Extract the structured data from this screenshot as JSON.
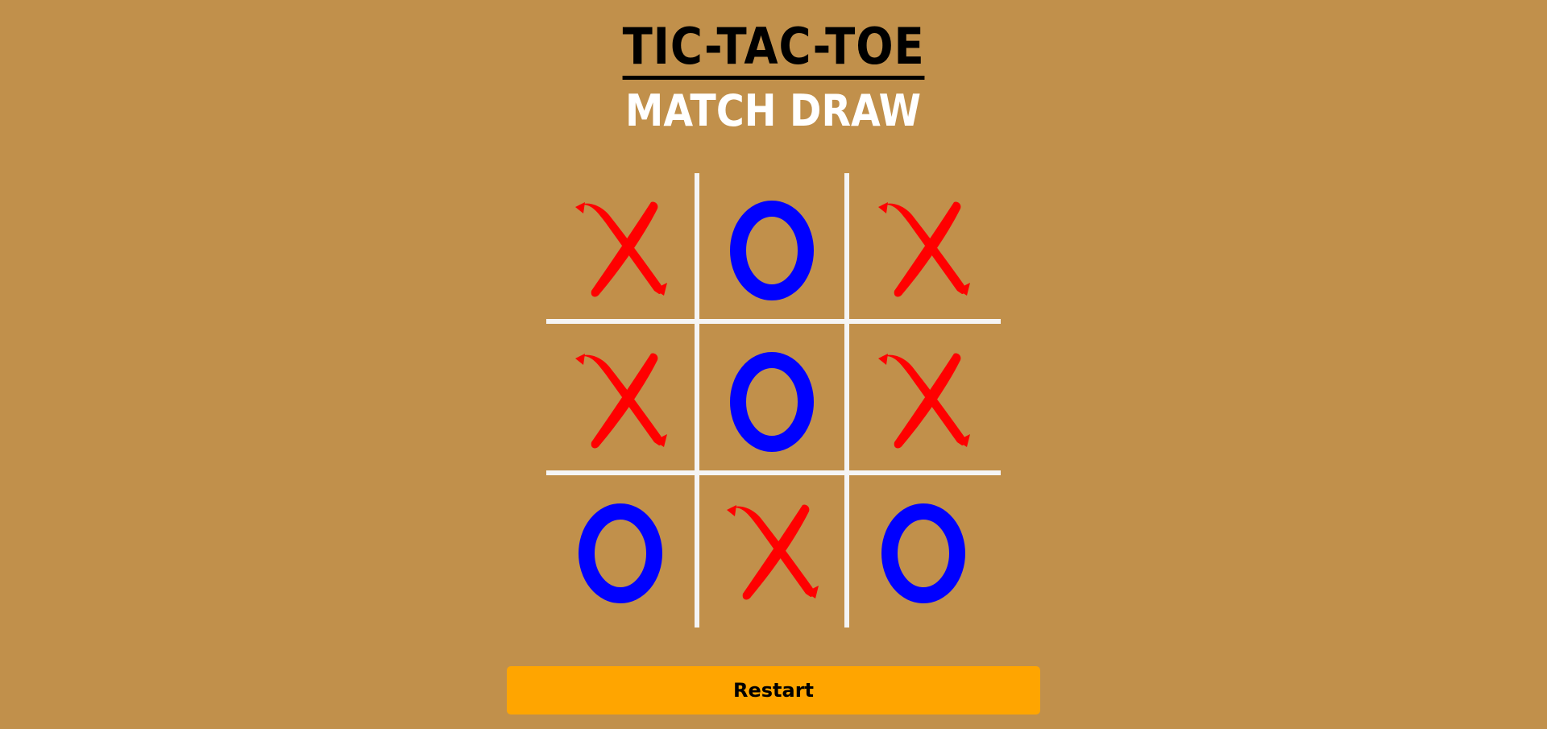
{
  "title": "TIC-TAC-TOE",
  "status": "MATCH DRAW",
  "board": {
    "cells": [
      "X",
      "O",
      "X",
      "X",
      "O",
      "X",
      "O",
      "X",
      "O"
    ]
  },
  "restart_label": "Restart",
  "colors": {
    "background": "#c1904b",
    "x_mark": "#ff0000",
    "o_mark": "#0000ff",
    "grid_lines": "#f5f5f5",
    "button": "#ffa500"
  }
}
